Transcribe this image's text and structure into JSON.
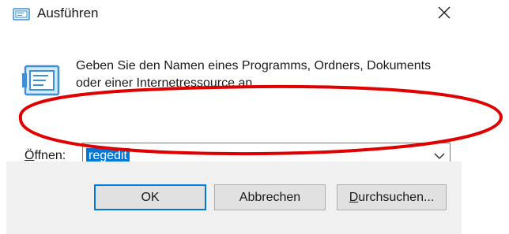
{
  "window": {
    "title": "Ausführen",
    "icon": "run-dialog-icon",
    "close_icon": "close-icon"
  },
  "dialog": {
    "icon": "run-program-icon",
    "description": "Geben Sie den Namen eines Programms, Ordners, Dokuments oder einer Internetressource an.",
    "open_label_first": "Ö",
    "open_label_rest": "ffnen:",
    "open_value": "regedit",
    "dropdown_icon": "chevron-down-icon"
  },
  "buttons": {
    "ok_label": "OK",
    "cancel_label": "Abbrechen",
    "browse_label_first": "D",
    "browse_label_rest": "urchsuchen..."
  },
  "annotation": {
    "shape": "ellipse",
    "color": "#e00000"
  },
  "colors": {
    "accent": "#0078d7",
    "button_bar": "#f0f0f0",
    "annotation": "#e00000"
  }
}
